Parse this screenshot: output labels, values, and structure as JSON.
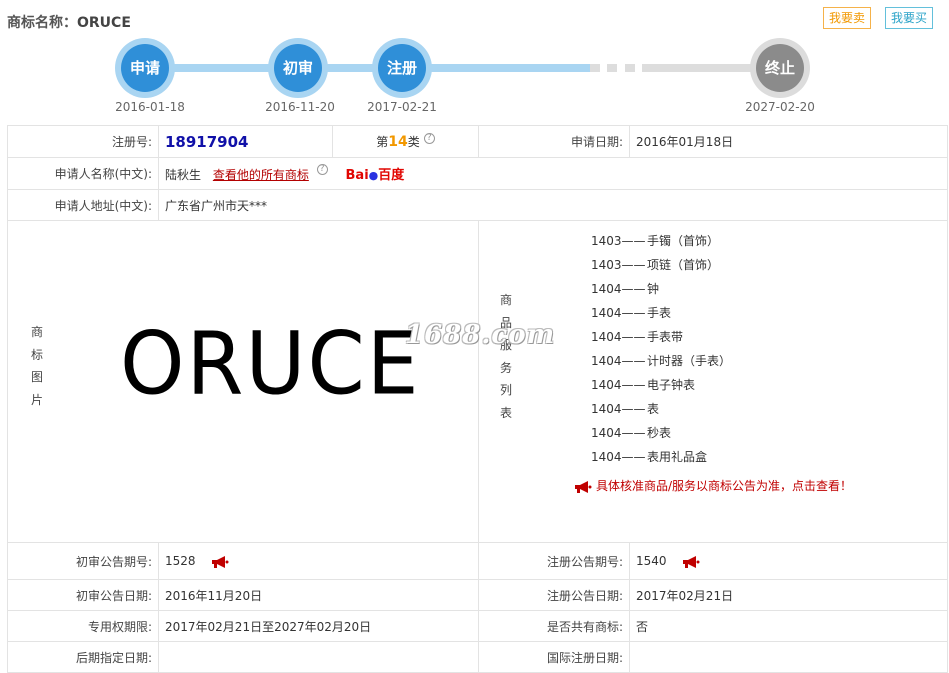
{
  "header": {
    "label": "商标名称：",
    "name": "ORUCE",
    "sell_button": "我要卖",
    "buy_button": "我要买"
  },
  "timeline": {
    "steps": [
      {
        "label": "申请",
        "date": "2016-01-18"
      },
      {
        "label": "初审",
        "date": "2016-11-20"
      },
      {
        "label": "注册",
        "date": "2017-02-21"
      },
      {
        "label": "终止",
        "date": "2027-02-20"
      }
    ]
  },
  "details": {
    "reg_no_label": "注册号:",
    "reg_no": "18917904",
    "class_prefix": "第",
    "class_num": "14",
    "class_suffix": "类",
    "apply_date_label": "申请日期:",
    "apply_date": "2016年01月18日",
    "applicant_label": "申请人名称(中文):",
    "applicant": "陆秋生",
    "all_marks_link": "查看他的所有商标",
    "baidu_bai": "Bai",
    "baidu_du": "百度",
    "address_label": "申请人地址(中文):",
    "address": "广东省广州市天***",
    "image_label": "商标图片",
    "image_text": "ORUCE",
    "watermark": "1688.com",
    "goods_label": "商品服务列表",
    "goods": [
      {
        "code": "1403——",
        "name": "手镯（首饰）"
      },
      {
        "code": "1403——",
        "name": "项链（首饰）"
      },
      {
        "code": "1404——",
        "name": "钟"
      },
      {
        "code": "1404——",
        "name": "手表"
      },
      {
        "code": "1404——",
        "name": "手表带"
      },
      {
        "code": "1404——",
        "name": "计时器（手表）"
      },
      {
        "code": "1404——",
        "name": "电子钟表"
      },
      {
        "code": "1404——",
        "name": "表"
      },
      {
        "code": "1404——",
        "name": "秒表"
      },
      {
        "code": "1404——",
        "name": "表用礼品盒"
      }
    ],
    "goods_note": "具体核准商品/服务以商标公告为准，点击查看！",
    "prelim_issue_label": "初审公告期号:",
    "prelim_issue": "1528",
    "reg_issue_label": "注册公告期号:",
    "reg_issue": "1540",
    "prelim_date_label": "初审公告日期:",
    "prelim_date": "2016年11月20日",
    "reg_date_label": "注册公告日期:",
    "reg_date": "2017年02月21日",
    "exclusive_label": "专用权期限:",
    "exclusive": "2017年02月21日至2027年02月20日",
    "shared_label": "是否共有商标:",
    "shared": "否",
    "later_label": "后期指定日期:",
    "later": "",
    "intl_label": "国际注册日期:",
    "intl": ""
  },
  "colors": {
    "step_active": "#2f8fd8",
    "step_active_ring": "#a9d5f2",
    "step_end": "#8b8b8b",
    "reg_no": "#1010a8",
    "class_num": "#f29800",
    "link": "#b30000",
    "note": "#c00000"
  }
}
